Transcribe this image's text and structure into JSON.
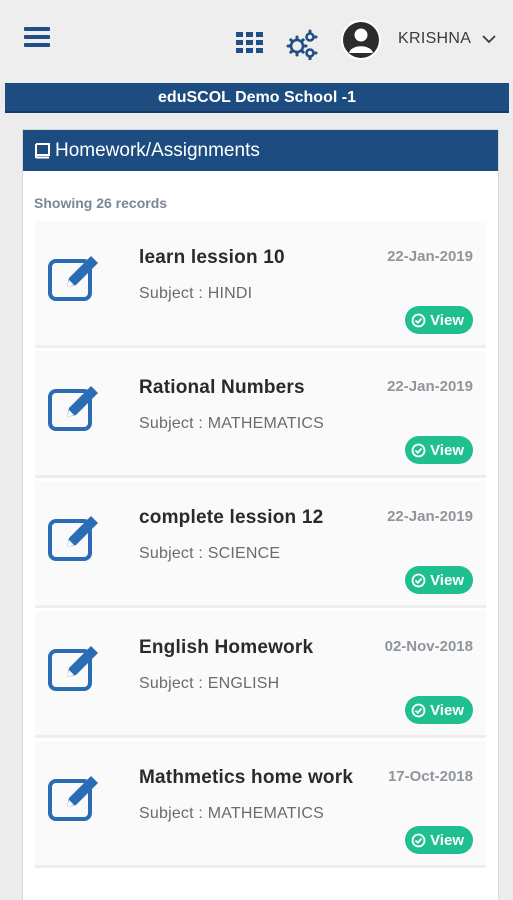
{
  "header": {
    "username": "KRISHNA",
    "icons": {
      "menu": "hamburger-menu-icon",
      "apps": "grid-apps-icon",
      "settings": "gears-icon",
      "avatar": "user-avatar-icon",
      "caret": "chevron-down-icon"
    }
  },
  "school": {
    "name": "eduSCOL Demo School -1"
  },
  "panel": {
    "title": "Homework/Assignments",
    "title_icon": "book-icon",
    "records_text": "Showing 26 records"
  },
  "items": [
    {
      "title": "learn lession 10",
      "subject": "Subject : HINDI",
      "date": "22-Jan-2019",
      "action": "View"
    },
    {
      "title": "Rational Numbers",
      "subject": "Subject : MATHEMATICS",
      "date": "22-Jan-2019",
      "action": "View"
    },
    {
      "title": "complete lession 12",
      "subject": "Subject : SCIENCE",
      "date": "22-Jan-2019",
      "action": "View"
    },
    {
      "title": "English Homework",
      "subject": "Subject : ENGLISH",
      "date": "02-Nov-2018",
      "action": "View"
    },
    {
      "title": "Mathmetics home work",
      "subject": "Subject : MATHEMATICS",
      "date": "17-Oct-2018",
      "action": "View"
    }
  ],
  "colors": {
    "brand_blue": "#1d4c81",
    "view_green": "#1fbf8f",
    "icon_blue": "#2a6db5"
  }
}
